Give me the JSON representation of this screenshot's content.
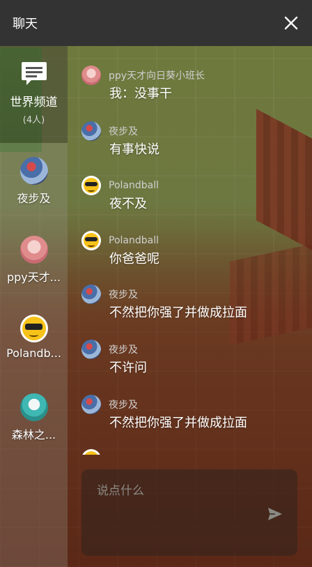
{
  "header": {
    "title": "聊天"
  },
  "sidebar": {
    "world_channel": {
      "label": "世界频道",
      "count": "(4人)"
    },
    "contacts": [
      {
        "name": "夜步及",
        "avatar": "yebuji"
      },
      {
        "name": "ppy天才...",
        "avatar": "ppy"
      },
      {
        "name": "Polandb...",
        "avatar": "polandball"
      },
      {
        "name": "森林之...",
        "avatar": "miku"
      }
    ]
  },
  "messages": [
    {
      "sender": "ppy天才向日葵小班长",
      "text": "我：没事干",
      "avatar": "ppy"
    },
    {
      "sender": "夜步及",
      "text": "有事快说",
      "avatar": "yebuji"
    },
    {
      "sender": "Polandball",
      "text": "夜不及",
      "avatar": "polandball"
    },
    {
      "sender": "Polandball",
      "text": "你爸爸呢",
      "avatar": "polandball"
    },
    {
      "sender": "夜步及",
      "text": "不然把你强了并做成拉面",
      "avatar": "yebuji"
    },
    {
      "sender": "夜步及",
      "text": "不许问",
      "avatar": "yebuji"
    },
    {
      "sender": "夜步及",
      "text": "不然把你强了并做成拉面",
      "avatar": "yebuji"
    }
  ],
  "input": {
    "placeholder": "说点什么"
  },
  "icons": {
    "close": "close-icon",
    "send": "send-icon",
    "chat": "chat-bubble-icon"
  },
  "colors": {
    "header_bg": "#333333",
    "text": "#ffffff",
    "sender_text": "#d0d0d0"
  }
}
